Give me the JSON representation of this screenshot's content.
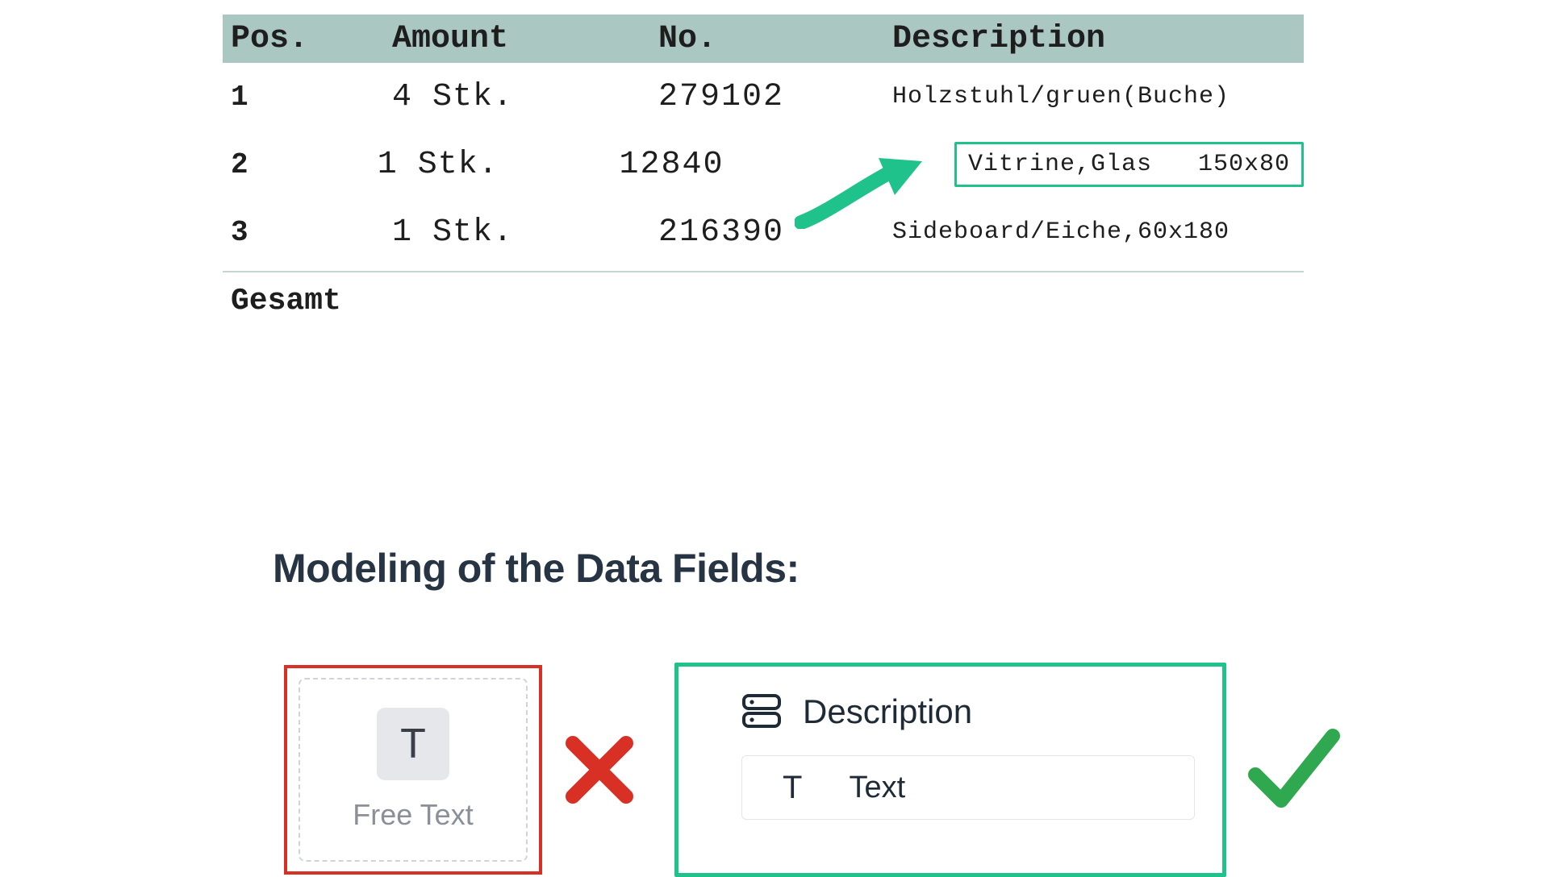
{
  "table": {
    "headers": {
      "pos": "Pos.",
      "amount": "Amount",
      "no": "No.",
      "desc": "Description"
    },
    "rows": [
      {
        "pos": "1",
        "amount": "4 Stk.",
        "no": "279102",
        "desc": "Holzstuhl/gruen(Buche)",
        "highlighted": false
      },
      {
        "pos": "2",
        "amount": "1 Stk.",
        "no": "12840",
        "desc": "Vitrine,Glas   150x80",
        "highlighted": true
      },
      {
        "pos": "3",
        "amount": "1 Stk.",
        "no": "216390",
        "desc": "Sideboard/Eiche,60x180",
        "highlighted": false
      }
    ],
    "total_label": "Gesamt"
  },
  "section_title": "Modeling of the Data Fields:",
  "wrong_card": {
    "label": "Free Text",
    "glyph": "T"
  },
  "correct_card": {
    "title": "Description",
    "chip_glyph": "T",
    "chip_label": "Text"
  },
  "colors": {
    "header_bg": "#abc7c1",
    "green": "#1fc28a",
    "red": "#d93025",
    "check_green": "#2fa84f"
  }
}
